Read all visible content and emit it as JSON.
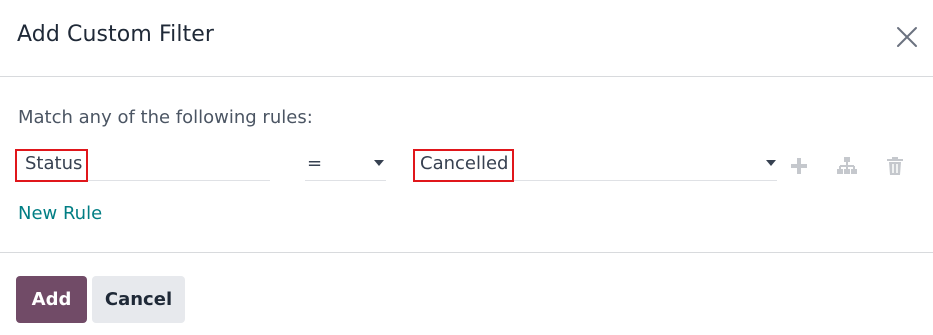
{
  "dialog": {
    "title": "Add Custom Filter",
    "close_icon": "close-icon"
  },
  "rules_intro": "Match any of the following rules:",
  "rule": {
    "path": "Status",
    "operator": "=",
    "value": "Cancelled",
    "actions": [
      "plus-icon",
      "sitemap-icon",
      "trash-icon"
    ]
  },
  "new_rule_label": "New Rule",
  "footer": {
    "add_label": "Add",
    "cancel_label": "Cancel"
  },
  "colors": {
    "primary": "#714b67",
    "link": "#017e84",
    "highlight": "#e0161b",
    "secondary_button": "#e7e9ed"
  }
}
